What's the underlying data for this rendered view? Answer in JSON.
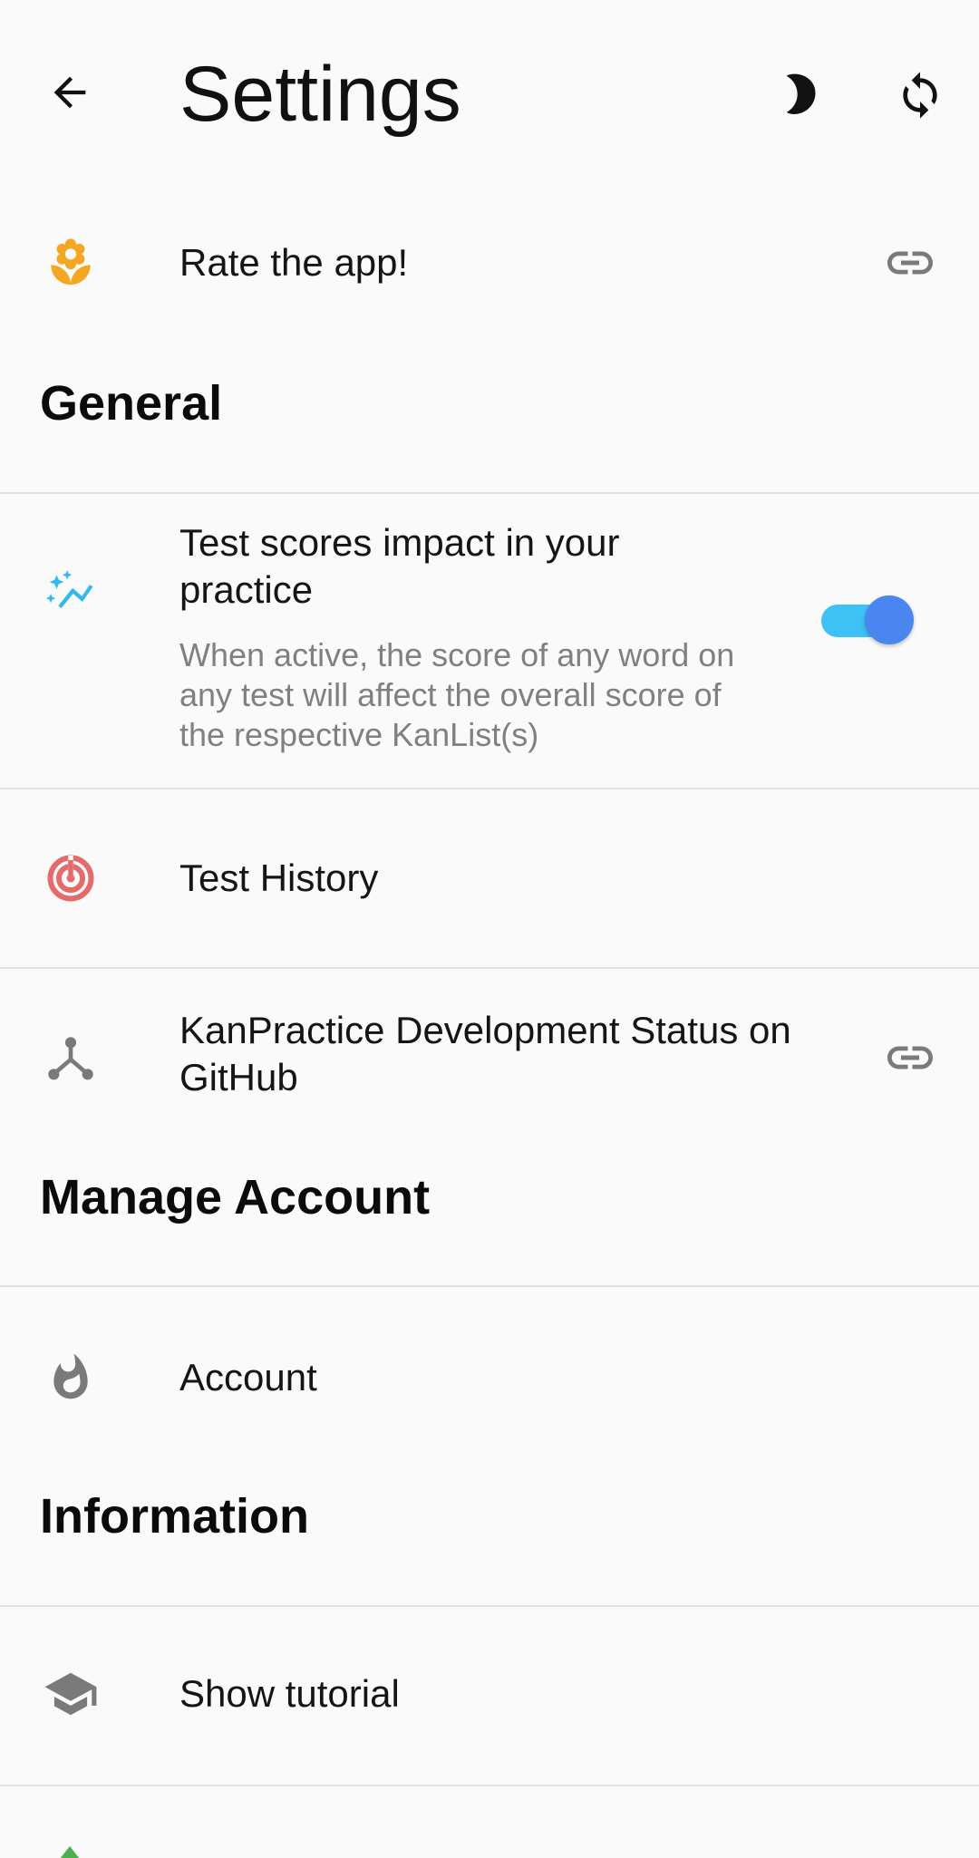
{
  "appbar": {
    "title": "Settings",
    "back_icon": "arrow-back-icon",
    "theme_icon": "moon-icon",
    "sync_icon": "sync-icon"
  },
  "rate": {
    "label": "Rate the app!",
    "icon": "flower-icon",
    "trailing_icon": "link-icon"
  },
  "sections": {
    "general": "General",
    "manage_account": "Manage Account",
    "information": "Information"
  },
  "general": {
    "test_scores": {
      "label": "Test scores impact in your practice",
      "description": "When active, the score of any word on any test will affect the overall score of the respective KanList(s)",
      "icon": "sparkle-chart-icon",
      "enabled": true
    },
    "test_history": {
      "label": "Test History",
      "icon": "target-icon"
    },
    "dev_status": {
      "label": "KanPractice Development Status on GitHub",
      "icon": "merge-icon",
      "trailing_icon": "link-icon"
    }
  },
  "account": {
    "label": "Account",
    "icon": "flame-icon"
  },
  "information": {
    "tutorial": {
      "label": "Show tutorial",
      "icon": "graduation-cap-icon"
    }
  },
  "colors": {
    "flower": "#f5a623",
    "sparkle": "#35b8f0",
    "target": "#e36b6b",
    "switch_track": "#3ec2f5",
    "switch_thumb": "#4a86f0",
    "gray_icon": "#7a7a7a"
  }
}
